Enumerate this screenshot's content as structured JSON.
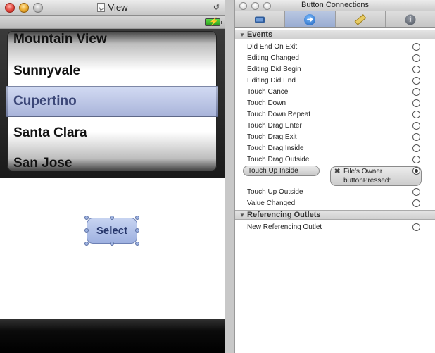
{
  "left_window": {
    "title": "View",
    "picker": {
      "rows": [
        "Mountain View",
        "Sunnyvale",
        "Cupertino",
        "Santa Clara",
        "San Jose"
      ],
      "selected": "Cupertino"
    },
    "select_button": {
      "label": "Select"
    }
  },
  "inspector": {
    "title": "Button Connections",
    "tabs": [
      {
        "name": "attributes",
        "icon": "slider-icon"
      },
      {
        "name": "connections",
        "icon": "arrow-circle-icon",
        "active": true
      },
      {
        "name": "size",
        "icon": "ruler-icon"
      },
      {
        "name": "identity",
        "icon": "info-icon",
        "glyph": "i"
      }
    ],
    "events_section": {
      "title": "Events",
      "items": [
        "Did End On Exit",
        "Editing Changed",
        "Editing Did Begin",
        "Editing Did End",
        "Touch Cancel",
        "Touch Down",
        "Touch Down Repeat",
        "Touch Drag Enter",
        "Touch Drag Exit",
        "Touch Drag Inside",
        "Touch Drag Outside",
        "Touch Up Inside",
        "Touch Up Outside",
        "Value Changed"
      ],
      "connection": {
        "event": "Touch Up Inside",
        "target": "File's Owner",
        "action": "buttonPressed:"
      }
    },
    "outlets_section": {
      "title": "Referencing Outlets",
      "items": [
        "New Referencing Outlet"
      ]
    }
  }
}
